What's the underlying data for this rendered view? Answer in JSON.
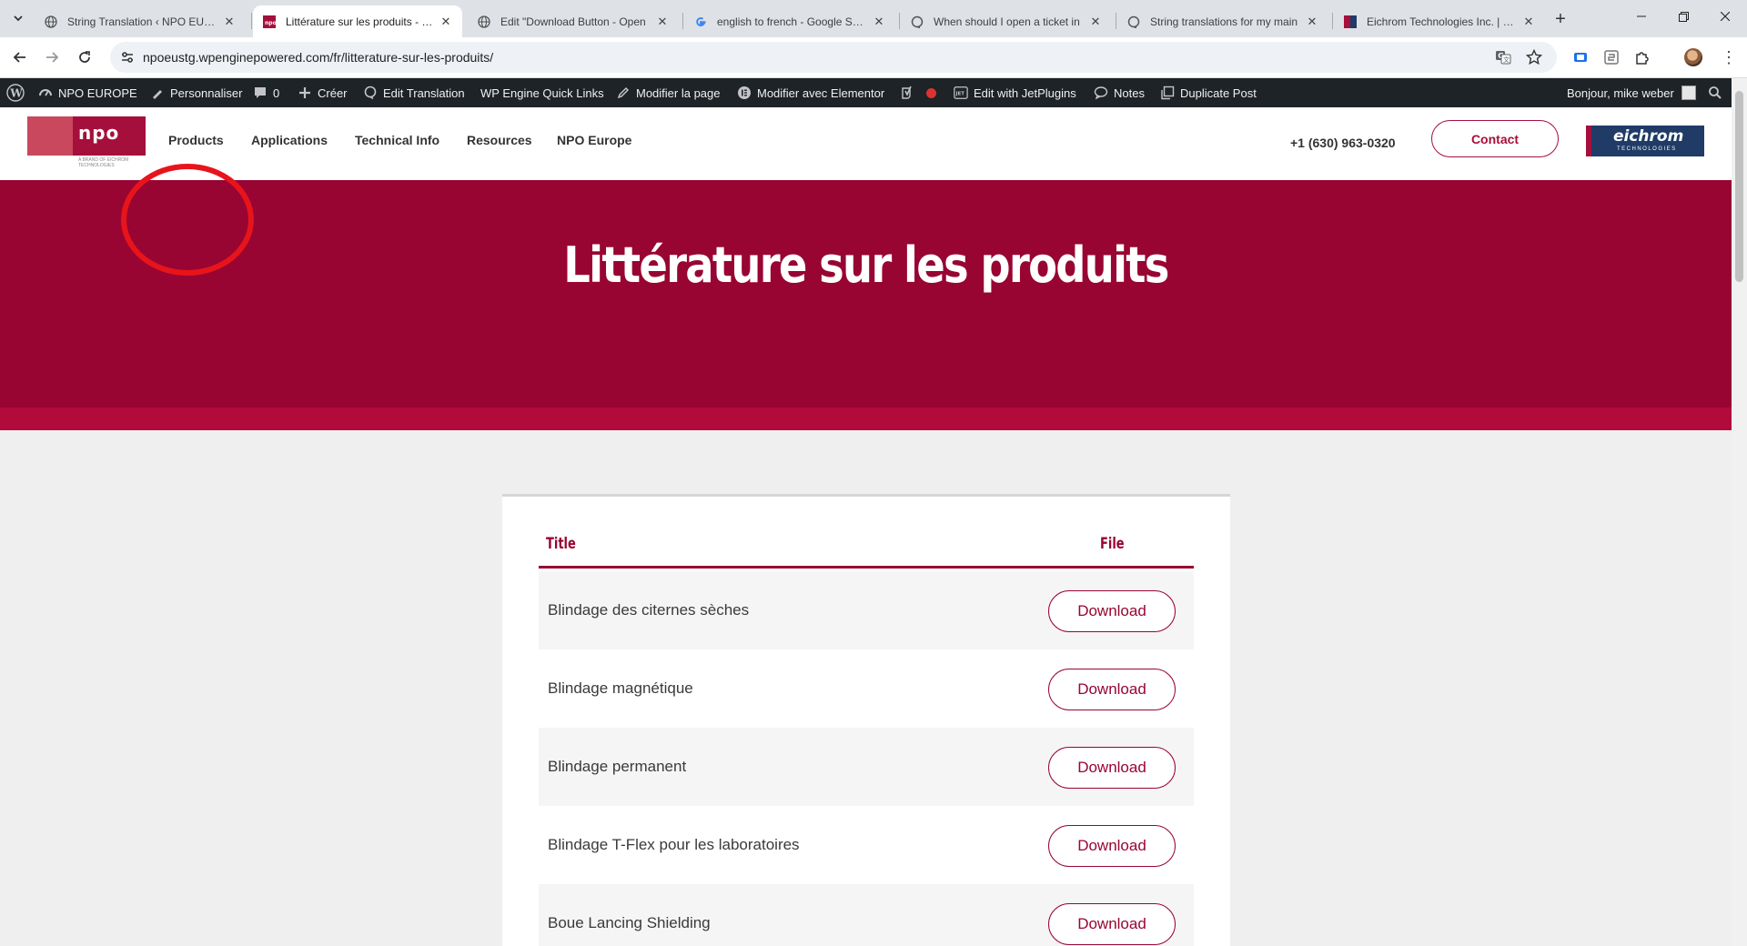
{
  "browser": {
    "tabs": [
      {
        "title": "String Translation ‹ NPO EUROPE",
        "active": false,
        "favicon": "globe-icon"
      },
      {
        "title": "Littérature sur les produits - NPO",
        "active": true,
        "favicon": "npo-icon"
      },
      {
        "title": "Edit \"Download Button - Open",
        "active": false,
        "favicon": "globe-icon"
      },
      {
        "title": "english to french - Google Search",
        "active": false,
        "favicon": "google-icon"
      },
      {
        "title": "When should I open a ticket in",
        "active": false,
        "favicon": "support-icon"
      },
      {
        "title": "String translations for my main",
        "active": false,
        "favicon": "support-icon"
      },
      {
        "title": "Eichrom Technologies Inc. | Radio",
        "active": false,
        "favicon": "eichrom-icon"
      }
    ],
    "url": "npoeustg.wpenginepowered.com/fr/litterature-sur-les-produits/"
  },
  "adminbar": {
    "site_name": "NPO EUROPE",
    "customize": "Personnaliser",
    "comments_count": "0",
    "new": "Créer",
    "edit_translation": "Edit Translation",
    "wp_engine": "WP Engine Quick Links",
    "edit_page": "Modifier la page",
    "edit_elementor": "Modifier avec Elementor",
    "jetplugins": "Edit with JetPlugins",
    "notes": "Notes",
    "duplicate": "Duplicate Post",
    "greeting": "Bonjour, mike weber"
  },
  "header": {
    "logo_text": "npo",
    "logo_sub": "A BRAND OF EICHROM TECHNOLOGIES",
    "nav": [
      "Products",
      "Applications",
      "Technical Info",
      "Resources",
      "NPO Europe"
    ],
    "phone": "+1 (630) 963-0320",
    "contact_label": "Contact",
    "partner_logo_text": "eichrom",
    "partner_logo_sub": "TECHNOLOGIES"
  },
  "hero": {
    "title": "Littérature sur les produits"
  },
  "table": {
    "headers": {
      "title": "Title",
      "file": "File"
    },
    "rows": [
      {
        "title": "Blindage des citernes sèches",
        "action": "Download"
      },
      {
        "title": "Blindage magnétique",
        "action": "Download"
      },
      {
        "title": "Blindage permanent",
        "action": "Download"
      },
      {
        "title": "Blindage T-Flex pour les laboratoires",
        "action": "Download"
      },
      {
        "title": "Boue Lancing Shielding",
        "action": "Download"
      }
    ]
  },
  "colors": {
    "brand": "#980532",
    "annotation": "#e8141b",
    "adminbar": "#1d2327"
  }
}
